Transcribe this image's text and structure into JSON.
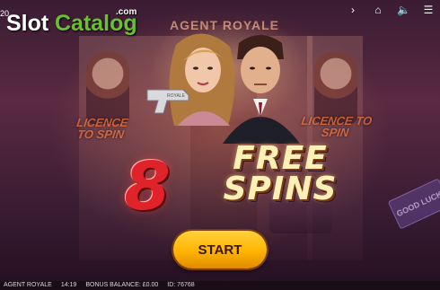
{
  "watermark": {
    "slot": "Slot",
    "catalog": "Catalog",
    "com": ".com"
  },
  "top_left_number": "20",
  "game": {
    "banner_title": "AGENT ROYALE",
    "side_label_left": "LICENCE TO SPIN",
    "side_label_right": "LICENCE TO SPIN",
    "gun_engraving": "ROYALE",
    "side_sign": "GOOD LUCK"
  },
  "award": {
    "count": "8",
    "line1": "FREE",
    "line2": "SPINS"
  },
  "start_button": {
    "label": "START"
  },
  "top_controls": [
    {
      "name": "next-arrow-icon",
      "glyph": "›"
    },
    {
      "name": "home-icon",
      "glyph": "⌂"
    },
    {
      "name": "sound-icon",
      "glyph": "🔈"
    },
    {
      "name": "menu-icon",
      "glyph": "☰"
    }
  ],
  "status_bar": {
    "game_name": "AGENT ROYALE",
    "time": "14:19",
    "balance": "BONUS BALANCE: £0.00",
    "id": "ID: 76768"
  },
  "colors": {
    "start_button": "#ffb400",
    "eight": "#e0232a",
    "free_spins": "#fff0b8",
    "catalog_green": "#69c12e"
  }
}
